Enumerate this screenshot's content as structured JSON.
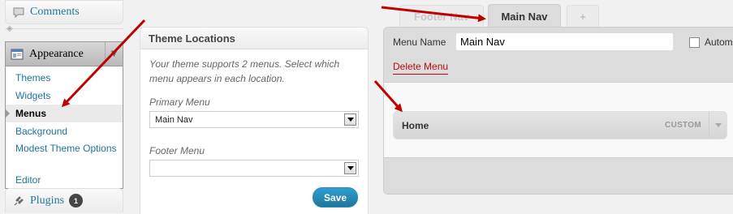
{
  "sidebar": {
    "comments_label": "Comments",
    "appearance_label": "Appearance",
    "plugins_label": "Plugins",
    "plugins_badge": "1",
    "submenu": [
      {
        "label": "Themes"
      },
      {
        "label": "Widgets"
      },
      {
        "label": "Menus",
        "current": true
      },
      {
        "label": "Background"
      },
      {
        "label": "Modest Theme Options"
      },
      {
        "label": "Editor"
      }
    ]
  },
  "locations": {
    "title": "Theme Locations",
    "description": "Your theme supports 2 menus. Select which menu appears in each location.",
    "primary_label": "Primary Menu",
    "primary_value": "Main Nav",
    "footer_label": "Footer Menu",
    "footer_value": "",
    "save_label": "Save"
  },
  "editor": {
    "tabs": [
      {
        "label": "Footer Nav"
      },
      {
        "label": "Main Nav",
        "active": true
      },
      {
        "label": "+"
      }
    ],
    "menu_name_label": "Menu Name",
    "menu_name_value": "Main Nav",
    "auto_add_label": "Automatically add new top-level pages",
    "delete_label": "Delete Menu",
    "items": [
      {
        "title": "Home",
        "type": "CUSTOM"
      }
    ]
  },
  "colors": {
    "link": "#21759b",
    "delete": "#bc0b0b",
    "arrow": "#c00000",
    "save_button": "#21759b"
  }
}
